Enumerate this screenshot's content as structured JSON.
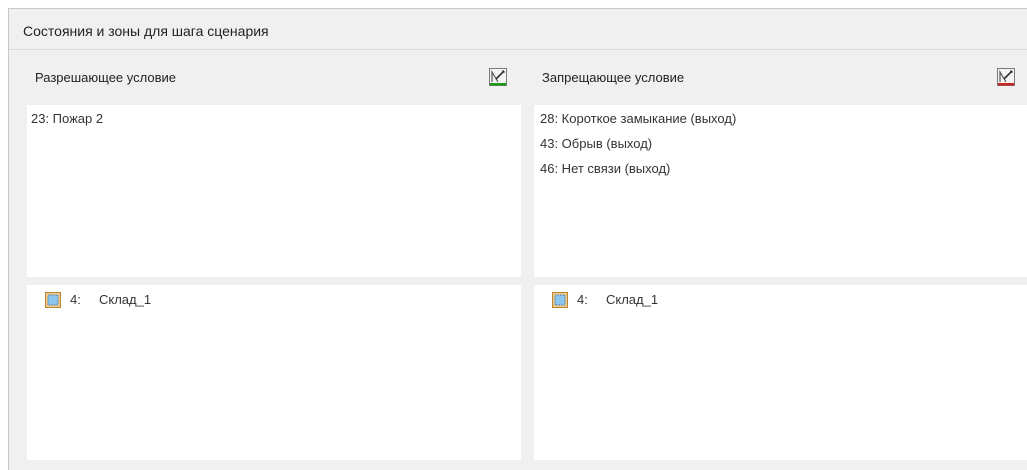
{
  "panel": {
    "title": "Состояния и зоны для шага сценария"
  },
  "left": {
    "label": "Разрешающее условие",
    "states": [
      "23:  Пожар 2"
    ],
    "zones": [
      {
        "num": "4:",
        "name": "Склад_1"
      }
    ]
  },
  "right": {
    "label": "Запрещающее условие",
    "states": [
      "28:  Короткое замыкание (выход)",
      "43:  Обрыв (выход)",
      "46:  Нет связи (выход)"
    ],
    "zones": [
      {
        "num": "4:",
        "name": "Склад_1"
      }
    ]
  },
  "icons": {
    "left_edit": "edit-condition-icon",
    "right_edit": "edit-condition-icon",
    "zone": "zone-icon"
  },
  "colors": {
    "allow_accent": "#1a9a1a",
    "deny_accent": "#cc2222"
  }
}
